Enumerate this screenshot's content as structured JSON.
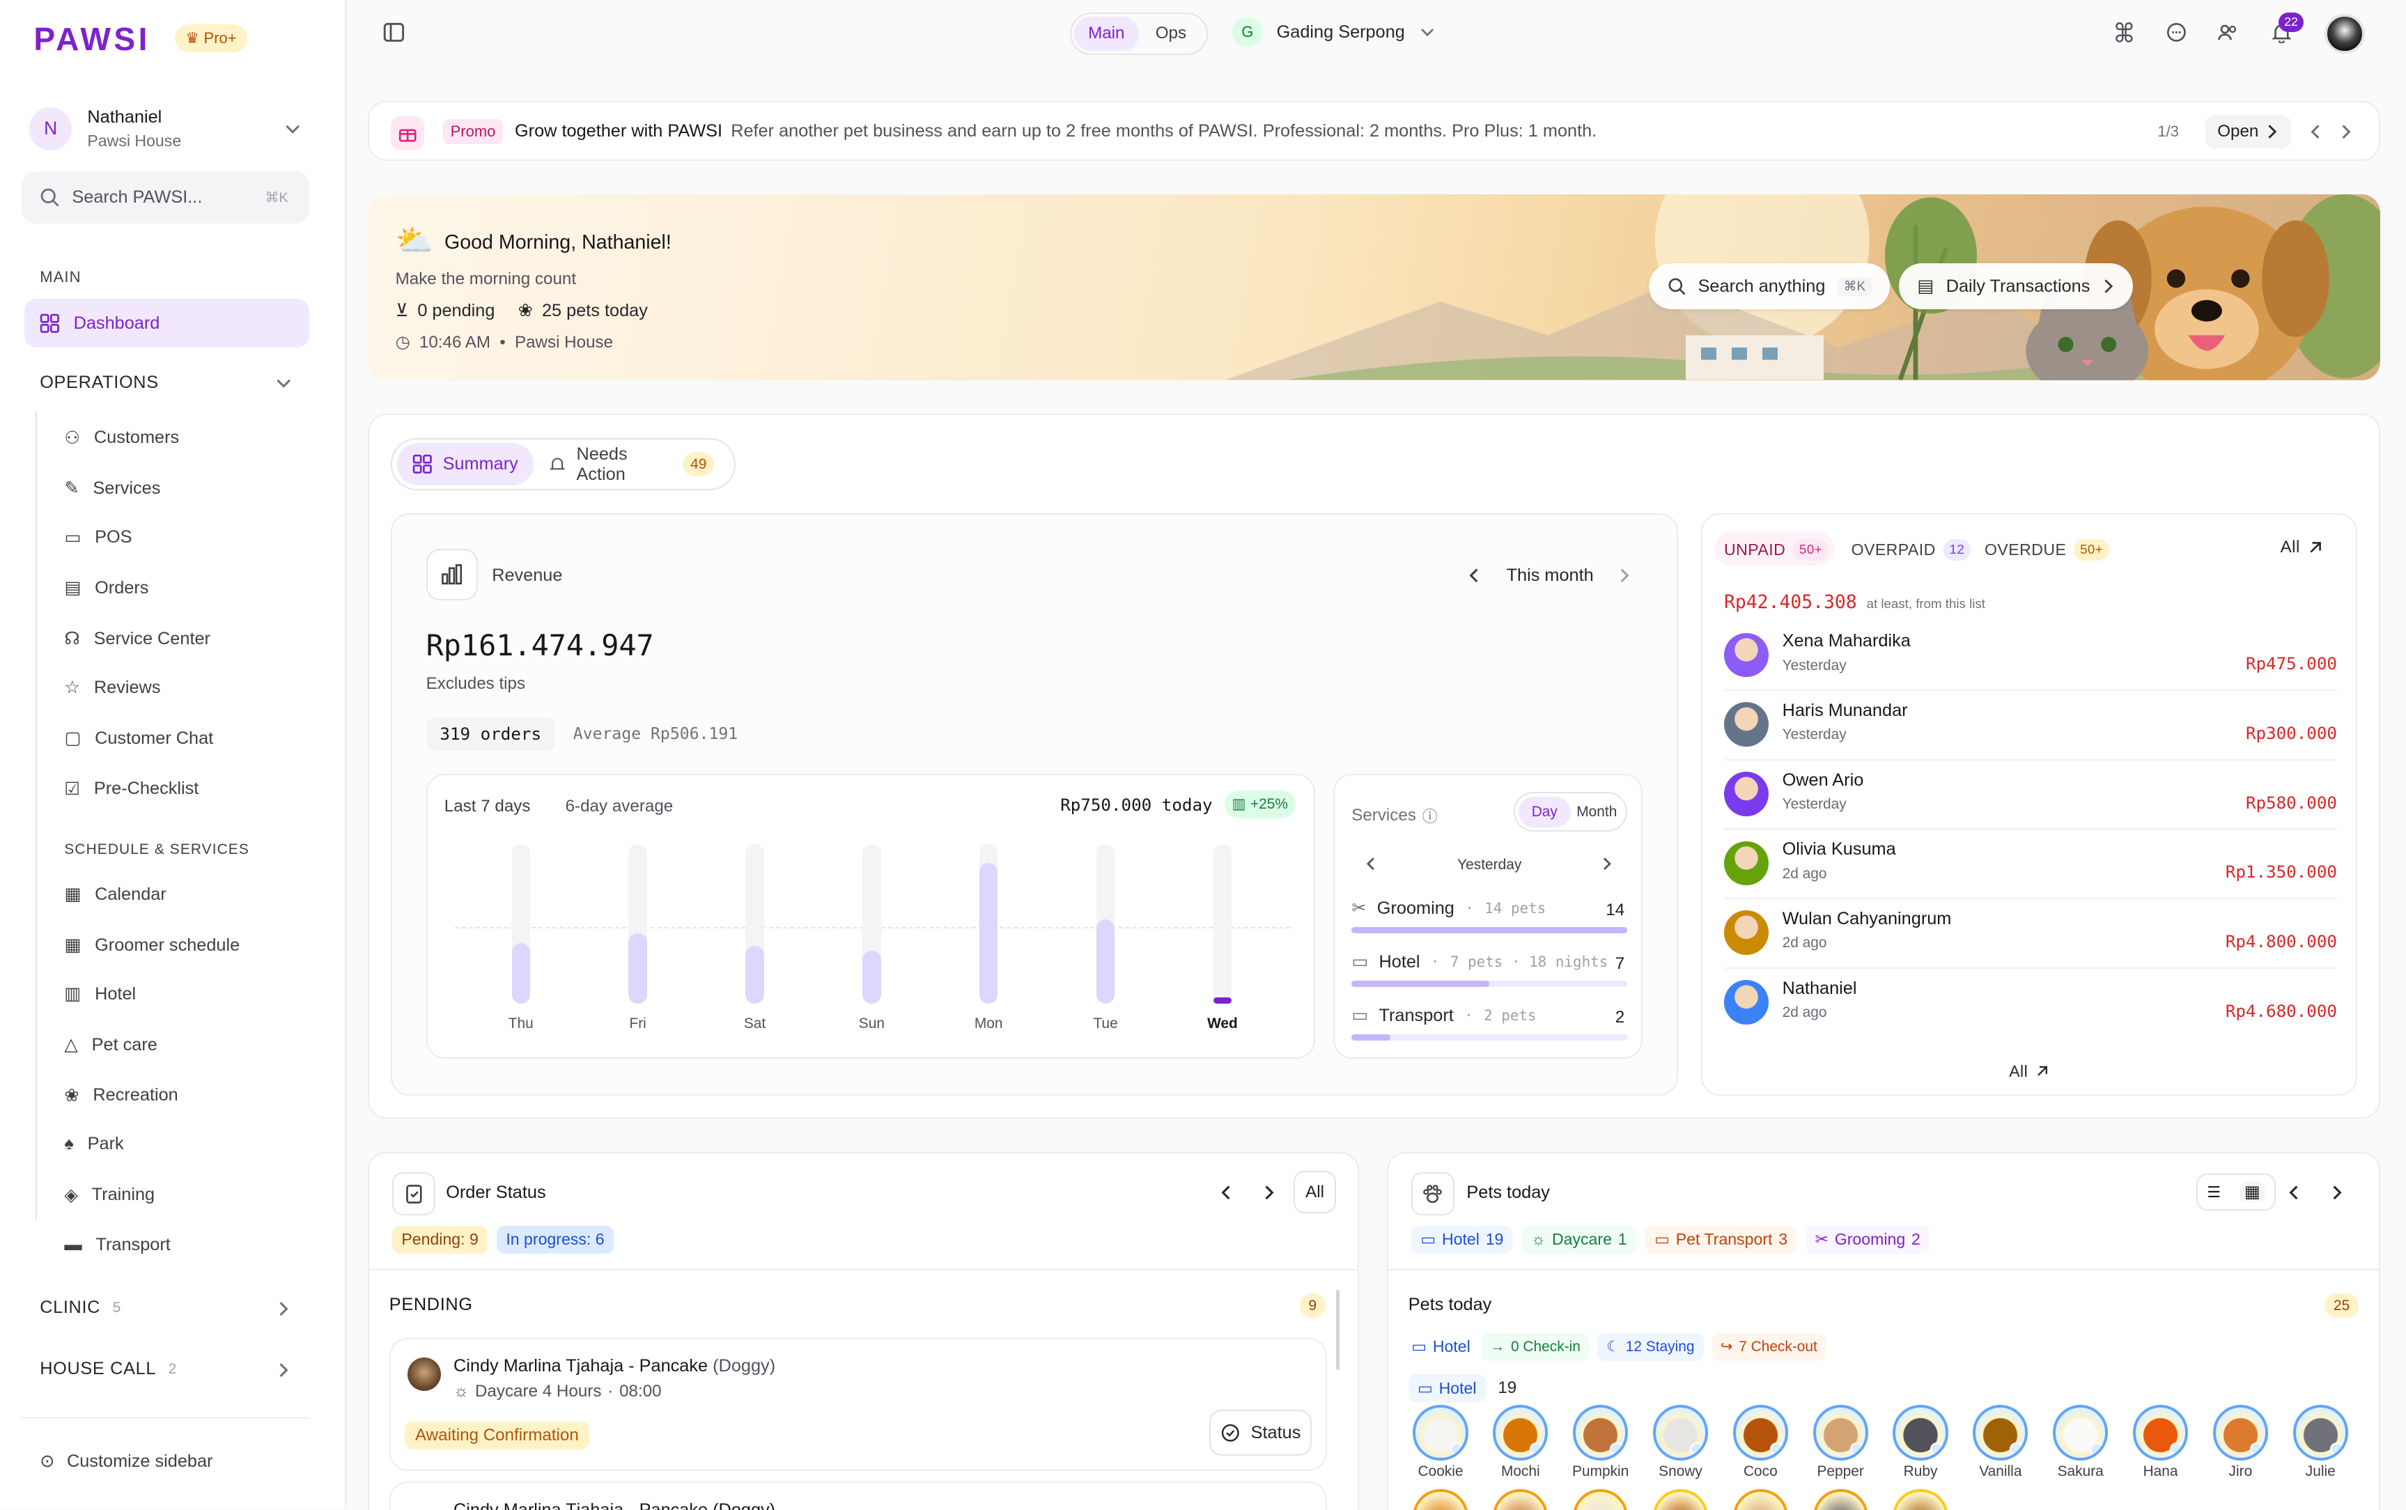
{
  "brand": {
    "name": "PAWSI",
    "plan": "Pro+"
  },
  "user": {
    "initial": "N",
    "name": "Nathaniel",
    "org": "Pawsi House"
  },
  "sidebar": {
    "search_placeholder": "Search PAWSI...",
    "search_shortcut": "⌘K",
    "main_label": "MAIN",
    "dashboard_label": "Dashboard",
    "operations_label": "OPERATIONS",
    "operations_items": [
      "Customers",
      "Services",
      "POS",
      "Orders",
      "Service Center",
      "Reviews",
      "Customer Chat",
      "Pre-Checklist"
    ],
    "schedule_label": "SCHEDULE & SERVICES",
    "schedule_items": [
      "Calendar",
      "Groomer schedule",
      "Hotel",
      "Pet care",
      "Recreation",
      "Park",
      "Training",
      "Transport"
    ],
    "clinic": {
      "label": "CLINIC",
      "count": "5"
    },
    "house_call": {
      "label": "HOUSE CALL",
      "count": "2"
    },
    "customize_label": "Customize sidebar"
  },
  "topbar": {
    "modes": [
      "Main",
      "Ops"
    ],
    "active_mode": "Main",
    "location_initial": "G",
    "location": "Gading Serpong",
    "notifications_count": "22"
  },
  "promo": {
    "tag": "Promo",
    "title": "Grow together with PAWSI",
    "text": "Refer another pet business and earn up to 2 free months of PAWSI. Professional: 2 months. Pro Plus: 1 month.",
    "pager": "1/3",
    "open_label": "Open"
  },
  "hero": {
    "greeting": "Good Morning, Nathaniel!",
    "subtitle": "Make the morning count",
    "pending": "0 pending",
    "pets_today": "25 pets today",
    "time": "10:46 AM",
    "location": "Pawsi House",
    "search_label": "Search anything",
    "search_shortcut": "⌘K",
    "daily_transactions": "Daily Transactions"
  },
  "summary_tabs": {
    "summary": "Summary",
    "needs_action": "Needs Action",
    "needs_action_count": "49"
  },
  "revenue": {
    "label": "Revenue",
    "period": "This month",
    "amount": "Rp161.474.947",
    "note": "Excludes tips",
    "orders": "319 orders",
    "average": "Average Rp506.191"
  },
  "chart_data": {
    "type": "bar",
    "title": "Last 7 days",
    "subtitle": "6-day average",
    "today_label": "Rp750.000 today",
    "change": "+25%",
    "categories": [
      "Thu",
      "Fri",
      "Sat",
      "Sun",
      "Mon",
      "Tue",
      "Wed"
    ],
    "values": [
      0.38,
      0.44,
      0.36,
      0.33,
      0.88,
      0.53,
      0.04
    ],
    "highlight": "Wed",
    "average": 0.48,
    "ylim": [
      0,
      1
    ]
  },
  "services": {
    "label": "Services",
    "toggle": [
      "Day",
      "Month"
    ],
    "active_toggle": "Day",
    "period": "Yesterday",
    "rows": [
      {
        "name": "Grooming",
        "meta": "14 pets",
        "value": "14",
        "fill": 1.0
      },
      {
        "name": "Hotel",
        "meta": "7 pets · 18 nights",
        "value": "7",
        "fill": 0.5
      },
      {
        "name": "Transport",
        "meta": "2 pets",
        "value": "2",
        "fill": 0.14
      }
    ]
  },
  "payments": {
    "tabs": [
      {
        "label": "UNPAID",
        "count": "50+"
      },
      {
        "label": "OVERPAID",
        "count": "12"
      },
      {
        "label": "OVERDUE",
        "count": "50+"
      }
    ],
    "all_label": "All",
    "total": "Rp42.405.308",
    "total_note": "at least, from this list",
    "rows": [
      {
        "name": "Xena Mahardika",
        "when": "Yesterday",
        "amount": "Rp475.000"
      },
      {
        "name": "Haris Munandar",
        "when": "Yesterday",
        "amount": "Rp300.000"
      },
      {
        "name": "Owen Ario",
        "when": "Yesterday",
        "amount": "Rp580.000"
      },
      {
        "name": "Olivia Kusuma",
        "when": "2d ago",
        "amount": "Rp1.350.000"
      },
      {
        "name": "Wulan Cahyaningrum",
        "when": "2d ago",
        "amount": "Rp4.800.000"
      },
      {
        "name": "Nathaniel",
        "when": "2d ago",
        "amount": "Rp4.680.000"
      }
    ],
    "footer_all": "All"
  },
  "order_status": {
    "title": "Order Status",
    "all_label": "All",
    "pending_chip": "Pending: 9",
    "progress_chip": "In progress: 6",
    "section": "PENDING",
    "section_count": "9",
    "card": {
      "title": "Cindy Marlina Tjahaja - Pancake",
      "pet_type": "(Doggy)",
      "service": "Daycare 4 Hours",
      "time": "08:00",
      "status": "Awaiting Confirmation",
      "status_btn": "Status"
    },
    "next_card_title": "Cindy Marlina Tjahaja - Pancake (Doggy)"
  },
  "pets_today": {
    "title": "Pets today",
    "chips": [
      {
        "label": "Hotel",
        "count": "19"
      },
      {
        "label": "Daycare",
        "count": "1"
      },
      {
        "label": "Pet Transport",
        "count": "3"
      },
      {
        "label": "Grooming",
        "count": "2"
      }
    ],
    "section": "Pets today",
    "section_count": "25",
    "hotel_label": "Hotel",
    "checkin": "0 Check-in",
    "staying": "12 Staying",
    "checkout": "7 Check-out",
    "hotel_group_label": "Hotel",
    "hotel_group_count": "19",
    "pets": [
      "Cookie",
      "Mochi",
      "Pumpkin",
      "Snowy",
      "Coco",
      "Pepper",
      "Ruby",
      "Vanilla",
      "Sakura",
      "Hana",
      "Jiro",
      "Julie"
    ]
  }
}
